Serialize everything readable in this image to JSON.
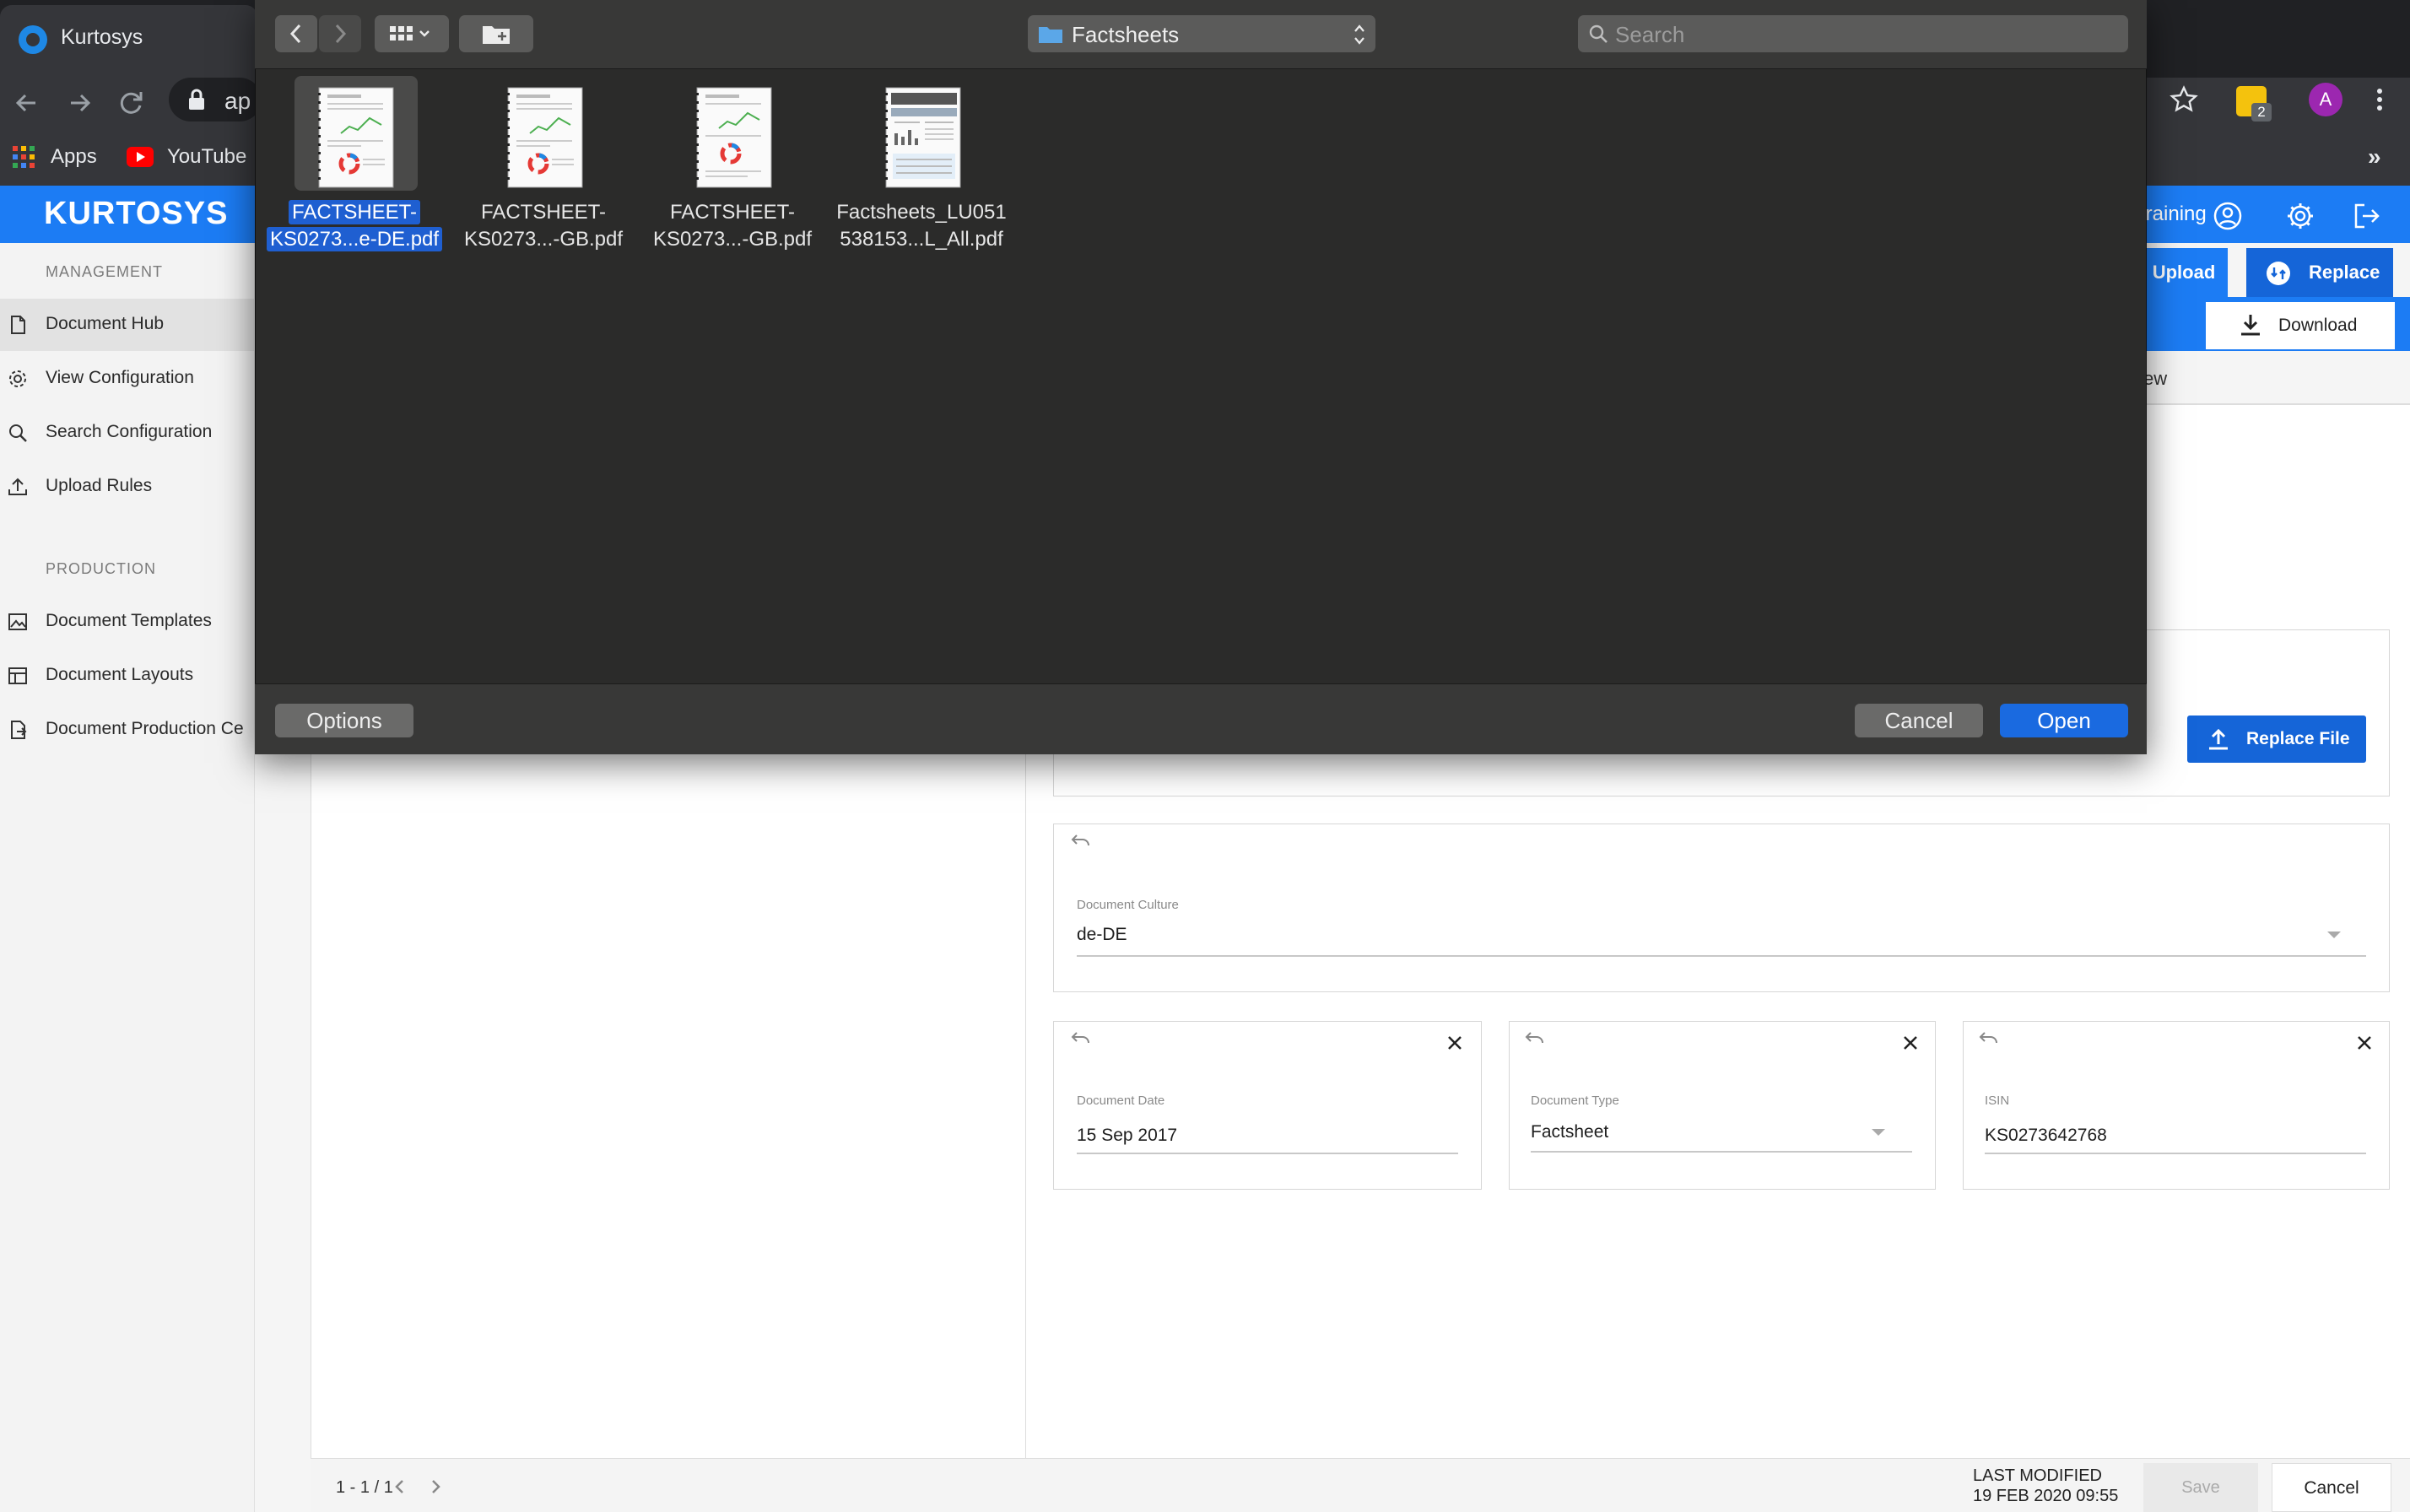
{
  "browser": {
    "tab_title": "Kurtosys",
    "url_fragment": "ap",
    "bookmarks": [
      {
        "label": "Apps",
        "icon": "apps-grid-icon"
      },
      {
        "label": "YouTube",
        "icon": "youtube-icon"
      }
    ],
    "more": "»",
    "extension_badge": "2",
    "profile_initial": "A"
  },
  "app": {
    "logo": "KURTOSYS",
    "user_name": "training",
    "accent_color": "#1c7cf4"
  },
  "sidebar": {
    "sections": [
      {
        "heading": "MANAGEMENT",
        "items": [
          {
            "label": "Document Hub",
            "icon": "document-icon",
            "active": true
          },
          {
            "label": "View Configuration",
            "icon": "gear-icon"
          },
          {
            "label": "Search Configuration",
            "icon": "search-icon"
          },
          {
            "label": "Upload Rules",
            "icon": "upload-icon"
          }
        ]
      },
      {
        "heading": "PRODUCTION",
        "items": [
          {
            "label": "Document Templates",
            "icon": "image-icon"
          },
          {
            "label": "Document Layouts",
            "icon": "layout-icon"
          },
          {
            "label": "Document Production Ce",
            "icon": "document-export-icon"
          }
        ]
      }
    ]
  },
  "actions": {
    "upload": "Upload",
    "replace": "Replace",
    "download": "Download",
    "preview_tab": "ew"
  },
  "detail": {
    "replace_file": "Replace File",
    "culture": {
      "label": "Document Culture",
      "value": "de-DE"
    },
    "date": {
      "label": "Document Date",
      "value": "15 Sep 2017"
    },
    "type": {
      "label": "Document Type",
      "value": "Factsheet"
    },
    "isin": {
      "label": "ISIN",
      "value": "KS0273642768"
    }
  },
  "list": {
    "pager": "1 - 1 / 1"
  },
  "footer": {
    "last_modified_label": "LAST MODIFIED",
    "last_modified_value": "19 FEB 2020 09:55",
    "save": "Save",
    "cancel": "Cancel"
  },
  "dialog": {
    "location": "Factsheets",
    "search_placeholder": "Search",
    "files": [
      {
        "line1": "FACTSHEET-",
        "line2": "KS0273...e-DE.pdf",
        "selected": true
      },
      {
        "line1": "FACTSHEET-",
        "line2": "KS0273...-GB.pdf",
        "selected": false
      },
      {
        "line1": "FACTSHEET-",
        "line2": "KS0273...-GB.pdf",
        "selected": false
      },
      {
        "line1": "Factsheets_LU051",
        "line2": "538153...L_All.pdf",
        "selected": false
      }
    ],
    "options": "Options",
    "cancel": "Cancel",
    "open": "Open"
  }
}
